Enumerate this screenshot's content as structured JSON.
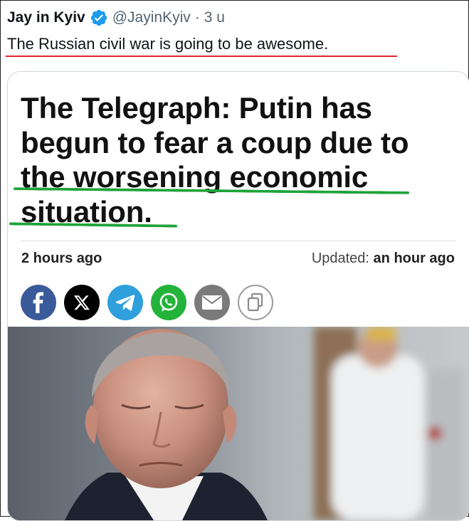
{
  "tweet": {
    "author_name": "Jay in Kyiv",
    "handle": "@JayinKyiv",
    "separator": "·",
    "time": "3 u",
    "text": "The Russian civil war is going to be awesome."
  },
  "article": {
    "headline_lines": [
      "The Telegraph: Putin has",
      "begun to fear a coup due to",
      "the worsening economic",
      "situation."
    ],
    "published": "2 hours ago",
    "updated_label": "Updated:",
    "updated_value": "an hour ago",
    "share_icons": [
      "facebook-icon",
      "x-icon",
      "telegram-icon",
      "whatsapp-icon",
      "email-icon",
      "copy-icon"
    ]
  },
  "colors": {
    "verified": "#1d9bf0",
    "red_underline": "#e0262b",
    "green_underline": "#1fa33a",
    "facebook": "#3b5a9a",
    "telegram": "#2fa0dc",
    "whatsapp": "#23b33a",
    "email": "#7a7a7a"
  }
}
